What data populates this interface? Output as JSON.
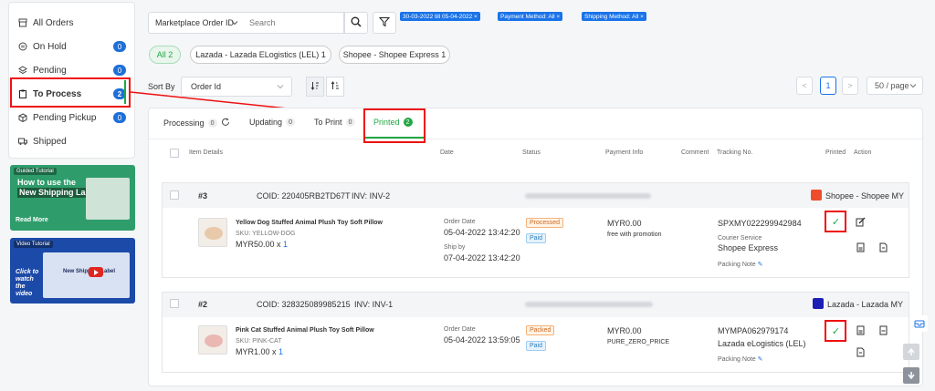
{
  "sidebar": {
    "items": [
      {
        "label": "All Orders",
        "icon": "archive-icon"
      },
      {
        "label": "On Hold",
        "icon": "pause-icon",
        "badge": "0"
      },
      {
        "label": "Pending",
        "icon": "layers-icon",
        "badge": "0"
      },
      {
        "label": "To Process",
        "icon": "clipboard-icon",
        "badge": "2"
      },
      {
        "label": "Pending Pickup",
        "icon": "box-icon",
        "badge": "0"
      },
      {
        "label": "Shipped",
        "icon": "truck-icon"
      }
    ]
  },
  "banners": {
    "guided": {
      "tag": "Guided Tutorial",
      "line1": "How to use the",
      "line2": "New Shipping Label?",
      "cta": "Read More"
    },
    "video": {
      "tag": "Video Tutorial",
      "cta": "Click to watch the video",
      "inner": "New Shipping Label"
    }
  },
  "filters": {
    "select_label": "Marketplace Order ID",
    "search_placeholder": "Search",
    "chips": [
      "30-03-2022 till 05-04-2022 ×",
      "Payment Method: All ×",
      "Shipping Method: All ×"
    ],
    "pills": [
      "All 2",
      "Lazada - Lazada ELogistics (LEL) 1",
      "Shopee - Shopee Express 1"
    ]
  },
  "sort": {
    "label": "Sort By",
    "value": "Order Id"
  },
  "pagination": {
    "prev": "<",
    "page": "1",
    "next": ">",
    "per_page": "50 / page"
  },
  "tabs": [
    {
      "label": "Processing",
      "count": "0"
    },
    {
      "label": "Updating",
      "count": "0"
    },
    {
      "label": "To Print",
      "count": "0"
    },
    {
      "label": "Printed",
      "count": "2"
    }
  ],
  "columns": [
    "Item Details",
    "Date",
    "Status",
    "Payment Info",
    "Comment",
    "Tracking No.",
    "Printed",
    "Action"
  ],
  "orders": [
    {
      "num": "#3",
      "coid": "COID: 220405RB2TD67T",
      "inv": "INV: INV-2",
      "marketplace": "Shopee - Shopee MY",
      "item_name": "Yellow Dog Stuffed Animal Plush Toy Soft Pillow",
      "sku": "SKU: YELLOW-DOG",
      "price": "MYR50.00 x ",
      "qty": "1",
      "date_label": "Order Date",
      "date": "05-04-2022 13:42:20",
      "ship_label": "Ship by",
      "ship_date": "07-04-2022 13:42:20",
      "status1": "Processed",
      "status2": "Paid",
      "pay_amount": "MYR0.00",
      "pay_note": "free with promotion",
      "tracking": "SPXMY022299942984",
      "courier_label": "Courier Service",
      "courier": "Shopee Express",
      "packing": "Packing Note"
    },
    {
      "num": "#2",
      "coid": "COID: 328325089985215",
      "inv": "INV: INV-1",
      "marketplace": "Lazada - Lazada MY",
      "item_name": "Pink Cat Stuffed Animal Plush Toy Soft Pillow",
      "sku": "SKU: PINK-CAT",
      "price": "MYR1.00 x ",
      "qty": "1",
      "date_label": "Order Date",
      "date": "05-04-2022 13:59:05",
      "status1": "Packed",
      "status2": "Paid",
      "pay_amount": "MYR0.00",
      "pay_note": "PURE_ZERO_PRICE",
      "tracking": "MYMPA062979174",
      "courier": "Lazada eLogistics (LEL)",
      "packing": "Packing Note"
    }
  ],
  "colors": {
    "accent_green": "#22a744",
    "primary_blue": "#1a73e8",
    "highlight_red": "#e11111"
  }
}
